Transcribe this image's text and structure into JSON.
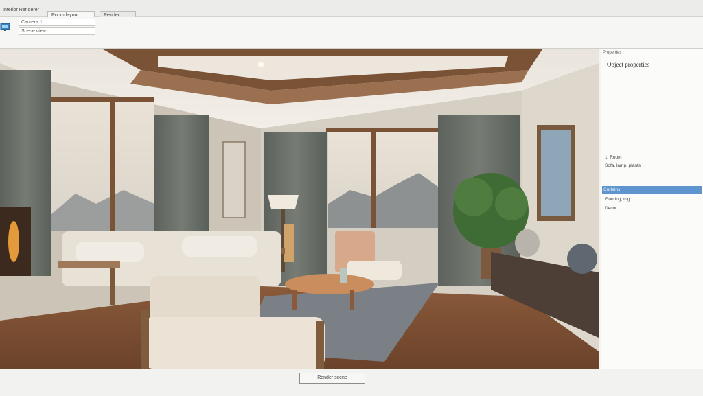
{
  "window": {
    "title": "Interior Renderer"
  },
  "tabs": [
    {
      "label": "Room layout"
    },
    {
      "label": "Render"
    }
  ],
  "toolbar": {
    "field_1": "Camera 1",
    "field_2": "Scene view"
  },
  "viewport": {},
  "right_panel": {
    "header": "Properties",
    "title": "Object properties",
    "items": [
      {
        "label": "1. Room"
      },
      {
        "label": "Sofa, lamp, plants"
      },
      {
        "label": "Curtains"
      },
      {
        "label": "Flooring, rug"
      },
      {
        "label": "Decor"
      }
    ],
    "selected_index": 2,
    "accent_color": "#5e95cf"
  },
  "status": {
    "button_label": "Render scene"
  },
  "icons": {
    "toolbar": "monitor-icon"
  }
}
